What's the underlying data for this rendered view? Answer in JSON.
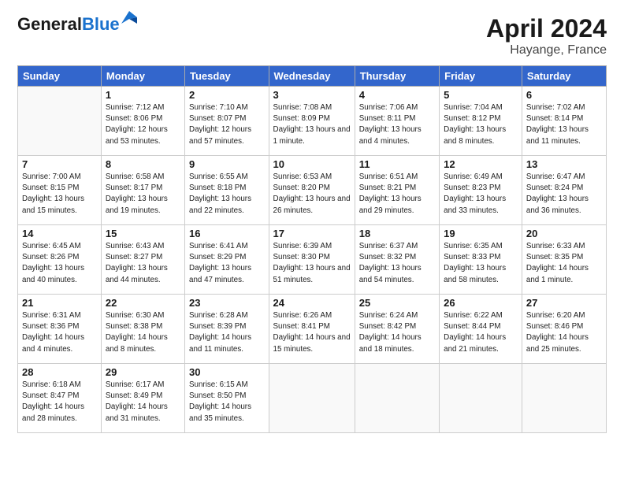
{
  "header": {
    "logo_general": "General",
    "logo_blue": "Blue",
    "title": "April 2024",
    "location": "Hayange, France"
  },
  "days_of_week": [
    "Sunday",
    "Monday",
    "Tuesday",
    "Wednesday",
    "Thursday",
    "Friday",
    "Saturday"
  ],
  "weeks": [
    [
      {
        "num": "",
        "sunrise": "",
        "sunset": "",
        "daylight": ""
      },
      {
        "num": "1",
        "sunrise": "Sunrise: 7:12 AM",
        "sunset": "Sunset: 8:06 PM",
        "daylight": "Daylight: 12 hours and 53 minutes."
      },
      {
        "num": "2",
        "sunrise": "Sunrise: 7:10 AM",
        "sunset": "Sunset: 8:07 PM",
        "daylight": "Daylight: 12 hours and 57 minutes."
      },
      {
        "num": "3",
        "sunrise": "Sunrise: 7:08 AM",
        "sunset": "Sunset: 8:09 PM",
        "daylight": "Daylight: 13 hours and 1 minute."
      },
      {
        "num": "4",
        "sunrise": "Sunrise: 7:06 AM",
        "sunset": "Sunset: 8:11 PM",
        "daylight": "Daylight: 13 hours and 4 minutes."
      },
      {
        "num": "5",
        "sunrise": "Sunrise: 7:04 AM",
        "sunset": "Sunset: 8:12 PM",
        "daylight": "Daylight: 13 hours and 8 minutes."
      },
      {
        "num": "6",
        "sunrise": "Sunrise: 7:02 AM",
        "sunset": "Sunset: 8:14 PM",
        "daylight": "Daylight: 13 hours and 11 minutes."
      }
    ],
    [
      {
        "num": "7",
        "sunrise": "Sunrise: 7:00 AM",
        "sunset": "Sunset: 8:15 PM",
        "daylight": "Daylight: 13 hours and 15 minutes."
      },
      {
        "num": "8",
        "sunrise": "Sunrise: 6:58 AM",
        "sunset": "Sunset: 8:17 PM",
        "daylight": "Daylight: 13 hours and 19 minutes."
      },
      {
        "num": "9",
        "sunrise": "Sunrise: 6:55 AM",
        "sunset": "Sunset: 8:18 PM",
        "daylight": "Daylight: 13 hours and 22 minutes."
      },
      {
        "num": "10",
        "sunrise": "Sunrise: 6:53 AM",
        "sunset": "Sunset: 8:20 PM",
        "daylight": "Daylight: 13 hours and 26 minutes."
      },
      {
        "num": "11",
        "sunrise": "Sunrise: 6:51 AM",
        "sunset": "Sunset: 8:21 PM",
        "daylight": "Daylight: 13 hours and 29 minutes."
      },
      {
        "num": "12",
        "sunrise": "Sunrise: 6:49 AM",
        "sunset": "Sunset: 8:23 PM",
        "daylight": "Daylight: 13 hours and 33 minutes."
      },
      {
        "num": "13",
        "sunrise": "Sunrise: 6:47 AM",
        "sunset": "Sunset: 8:24 PM",
        "daylight": "Daylight: 13 hours and 36 minutes."
      }
    ],
    [
      {
        "num": "14",
        "sunrise": "Sunrise: 6:45 AM",
        "sunset": "Sunset: 8:26 PM",
        "daylight": "Daylight: 13 hours and 40 minutes."
      },
      {
        "num": "15",
        "sunrise": "Sunrise: 6:43 AM",
        "sunset": "Sunset: 8:27 PM",
        "daylight": "Daylight: 13 hours and 44 minutes."
      },
      {
        "num": "16",
        "sunrise": "Sunrise: 6:41 AM",
        "sunset": "Sunset: 8:29 PM",
        "daylight": "Daylight: 13 hours and 47 minutes."
      },
      {
        "num": "17",
        "sunrise": "Sunrise: 6:39 AM",
        "sunset": "Sunset: 8:30 PM",
        "daylight": "Daylight: 13 hours and 51 minutes."
      },
      {
        "num": "18",
        "sunrise": "Sunrise: 6:37 AM",
        "sunset": "Sunset: 8:32 PM",
        "daylight": "Daylight: 13 hours and 54 minutes."
      },
      {
        "num": "19",
        "sunrise": "Sunrise: 6:35 AM",
        "sunset": "Sunset: 8:33 PM",
        "daylight": "Daylight: 13 hours and 58 minutes."
      },
      {
        "num": "20",
        "sunrise": "Sunrise: 6:33 AM",
        "sunset": "Sunset: 8:35 PM",
        "daylight": "Daylight: 14 hours and 1 minute."
      }
    ],
    [
      {
        "num": "21",
        "sunrise": "Sunrise: 6:31 AM",
        "sunset": "Sunset: 8:36 PM",
        "daylight": "Daylight: 14 hours and 4 minutes."
      },
      {
        "num": "22",
        "sunrise": "Sunrise: 6:30 AM",
        "sunset": "Sunset: 8:38 PM",
        "daylight": "Daylight: 14 hours and 8 minutes."
      },
      {
        "num": "23",
        "sunrise": "Sunrise: 6:28 AM",
        "sunset": "Sunset: 8:39 PM",
        "daylight": "Daylight: 14 hours and 11 minutes."
      },
      {
        "num": "24",
        "sunrise": "Sunrise: 6:26 AM",
        "sunset": "Sunset: 8:41 PM",
        "daylight": "Daylight: 14 hours and 15 minutes."
      },
      {
        "num": "25",
        "sunrise": "Sunrise: 6:24 AM",
        "sunset": "Sunset: 8:42 PM",
        "daylight": "Daylight: 14 hours and 18 minutes."
      },
      {
        "num": "26",
        "sunrise": "Sunrise: 6:22 AM",
        "sunset": "Sunset: 8:44 PM",
        "daylight": "Daylight: 14 hours and 21 minutes."
      },
      {
        "num": "27",
        "sunrise": "Sunrise: 6:20 AM",
        "sunset": "Sunset: 8:46 PM",
        "daylight": "Daylight: 14 hours and 25 minutes."
      }
    ],
    [
      {
        "num": "28",
        "sunrise": "Sunrise: 6:18 AM",
        "sunset": "Sunset: 8:47 PM",
        "daylight": "Daylight: 14 hours and 28 minutes."
      },
      {
        "num": "29",
        "sunrise": "Sunrise: 6:17 AM",
        "sunset": "Sunset: 8:49 PM",
        "daylight": "Daylight: 14 hours and 31 minutes."
      },
      {
        "num": "30",
        "sunrise": "Sunrise: 6:15 AM",
        "sunset": "Sunset: 8:50 PM",
        "daylight": "Daylight: 14 hours and 35 minutes."
      },
      {
        "num": "",
        "sunrise": "",
        "sunset": "",
        "daylight": ""
      },
      {
        "num": "",
        "sunrise": "",
        "sunset": "",
        "daylight": ""
      },
      {
        "num": "",
        "sunrise": "",
        "sunset": "",
        "daylight": ""
      },
      {
        "num": "",
        "sunrise": "",
        "sunset": "",
        "daylight": ""
      }
    ]
  ]
}
